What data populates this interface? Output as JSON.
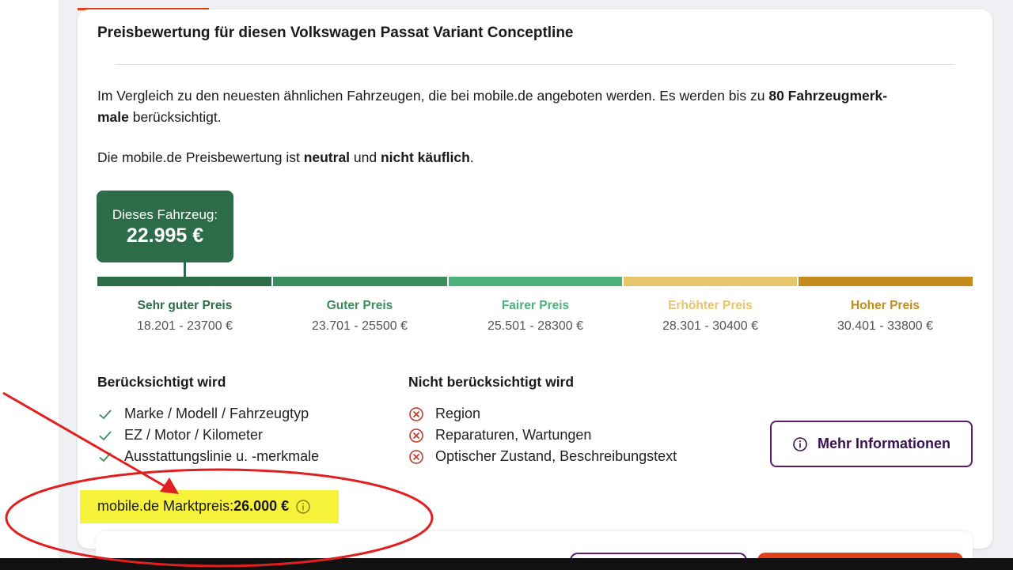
{
  "title": "Preisbewertung für diesen Volkswagen Passat Variant Conceptline",
  "intro": {
    "part1": "Im Vergleich zu den neuesten ähnlichen Fahrzeugen, die bei mobile.de angeboten werden. Es werden bis zu ",
    "bold": "80 Fahrzeugmerk-",
    "bold2": "male",
    "part2": " berücksichtigt."
  },
  "neutral": {
    "part1": "Die mobile.de Preisbewertung ist ",
    "bold1": "neutral",
    "part2": " und ",
    "bold2": "nicht käuflich",
    "part3": "."
  },
  "vehicle": {
    "label": "Dieses Fahrzeug:",
    "price": "22.995 €"
  },
  "segments": [
    {
      "label": "Sehr guter Preis",
      "range": "18.201 - 23700 €",
      "color": "#2c6c48",
      "text_color": "#2c6c48"
    },
    {
      "label": "Guter Preis",
      "range": "23.701 - 25500 €",
      "color": "#3c8c5e",
      "text_color": "#3c8c5e"
    },
    {
      "label": "Fairer Preis",
      "range": "25.501 - 28300 €",
      "color": "#4cb07b",
      "text_color": "#4cb07b"
    },
    {
      "label": "Erhöhter Preis",
      "range": "28.301 - 30400 €",
      "color": "#e8c56c",
      "text_color": "#e8c56c"
    },
    {
      "label": "Hoher Preis",
      "range": "30.401 - 33800 €",
      "color": "#c38c1c",
      "text_color": "#c38c1c"
    }
  ],
  "considered": {
    "heading": "Berücksichtigt wird",
    "items": [
      "Marke / Modell / Fahrzeugtyp",
      "EZ / Motor / Kilometer",
      "Ausstattungslinie u. -merkmale"
    ]
  },
  "not_considered": {
    "heading": "Nicht berücksichtigt wird",
    "items": [
      "Region",
      "Reparaturen, Wartungen",
      "Optischer Zustand, Beschreibungstext"
    ]
  },
  "more_button": {
    "label": "Mehr Informationen",
    "icon": "info-icon"
  },
  "market": {
    "label": "mobile.de Marktpreis: ",
    "value": "26.000 €",
    "icon": "info-icon"
  },
  "colors": {
    "accent_purple": "#5b1c70",
    "brand_orange": "#e0431c",
    "highlight_yellow": "#f7f23a",
    "annotation_red": "#e02020",
    "check_green": "#3c8c5e",
    "x_red": "#c0392b"
  }
}
